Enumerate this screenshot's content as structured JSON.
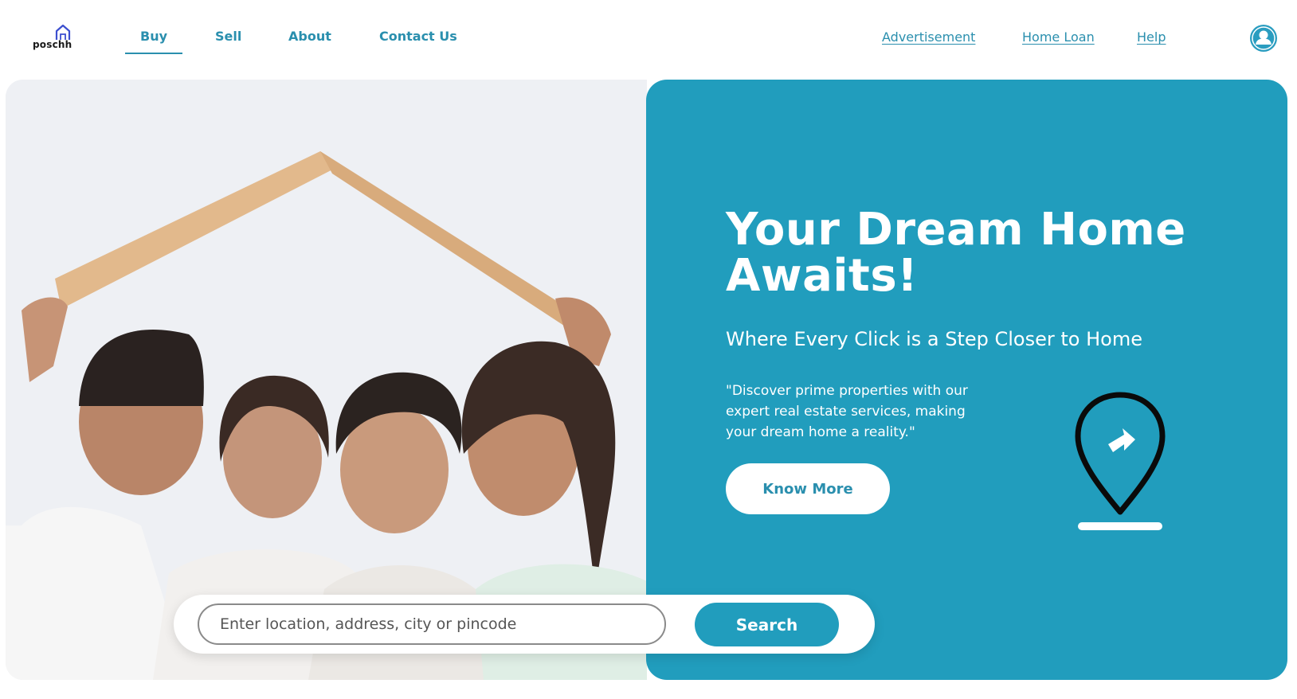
{
  "brand": {
    "logo_text": "poschh"
  },
  "nav": {
    "left": [
      {
        "label": "Buy",
        "active": true
      },
      {
        "label": "Sell",
        "active": false
      },
      {
        "label": "About",
        "active": false
      },
      {
        "label": "Contact Us",
        "active": false
      }
    ],
    "right": [
      {
        "label": "Advertisement"
      },
      {
        "label": "Home Loan"
      },
      {
        "label": "Help"
      }
    ],
    "user_icon": "user-avatar-icon"
  },
  "hero": {
    "image": "family-under-cardboard-roof-photo",
    "title": "Your Dream Home Awaits!",
    "subtitle": "Where Every Click is a Step Closer to Home",
    "quote": "\"Discover prime properties with our expert real estate services, making your dream home a reality.\"",
    "cta_label": "Know More",
    "illustration_icon": "location-pin-icon"
  },
  "search": {
    "placeholder": "Enter location, address, city or pincode",
    "value": "",
    "button_label": "Search"
  },
  "colors": {
    "accent": "#219dbd",
    "nav_text": "#2a8fae",
    "panel_text": "#ffffff"
  }
}
